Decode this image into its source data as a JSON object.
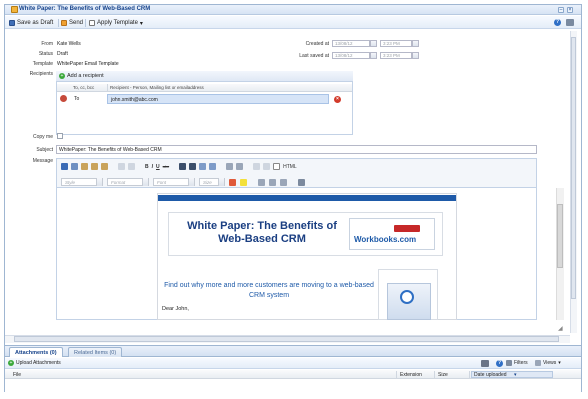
{
  "window": {
    "title": "White Paper: The Benefits of Web-Based CRM",
    "minimize_glyph": "–",
    "close_glyph": "×"
  },
  "toolbar": {
    "save_draft": "Save as Draft",
    "send": "Send",
    "apply_template": "Apply Template",
    "apply_template_caret": "▾",
    "help_glyph": "?"
  },
  "form": {
    "from_label": "From",
    "from_value": "Kate Wells",
    "status_label": "Status",
    "status_value": "Draft",
    "template_label": "Template",
    "template_value": "WhitePaper Email Template",
    "recipients_label": "Recipients",
    "created_at_label": "Created at",
    "created_at_date": "13/08/12",
    "created_at_time": "3:23 PM",
    "last_saved_label": "Last saved at",
    "last_saved_date": "13/08/12",
    "last_saved_time": "3:23 PM",
    "copy_me_label": "Copy me",
    "subject_label": "Subject",
    "subject_value": "WhitePaper: The Benefits of Web-Based CRM",
    "message_label": "Message"
  },
  "recipients": {
    "add_label": "Add a recipient",
    "columns": [
      "To, cc, bcc",
      "Recipient - Person, Mailing list or emailaddress"
    ],
    "rows": [
      {
        "type": "To",
        "address": "john.smith@abc.com"
      }
    ]
  },
  "editor": {
    "html_label": "HTML",
    "combos": {
      "style": "Style",
      "format": "Format",
      "font": "Font",
      "size": "Size"
    },
    "bold": "B",
    "italic": "I",
    "underline": "U",
    "strike": "abc"
  },
  "email": {
    "banner_title": "White Paper: The Benefits of Web-Based CRM",
    "logo_text": "Workbooks.com",
    "subheading": "Find out why more and more customers are moving to a web-based CRM system",
    "greeting": "Dear John,"
  },
  "bottom": {
    "tab_attachments": "Attachments (0)",
    "tab_related": "Related Items (0)",
    "upload": "Upload Attachments",
    "filters": "Filters",
    "views": "Views",
    "columns": [
      "File",
      "Extension",
      "Size",
      "Date uploaded"
    ]
  },
  "colors": {
    "accent": "#15428b",
    "brand_blue": "#1e5aa8",
    "row_highlight": "#d6e4f7"
  }
}
